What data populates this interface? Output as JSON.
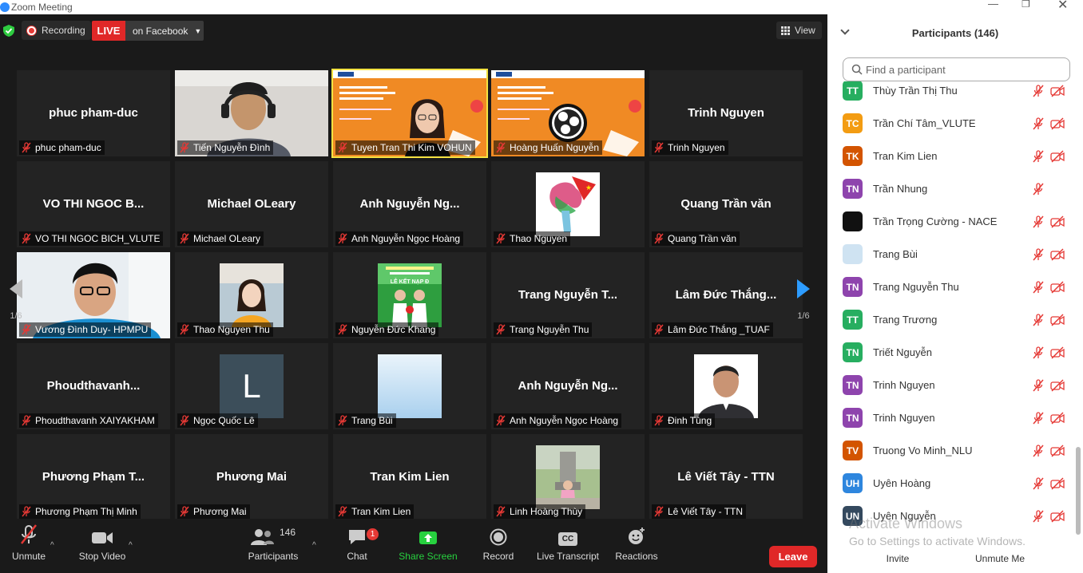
{
  "window": {
    "title": "Zoom Meeting"
  },
  "topbar": {
    "recording_label": "Recording",
    "live_badge": "LIVE",
    "live_target": "on Facebook",
    "view_label": "View"
  },
  "pager": {
    "left": "1/6",
    "right": "1/6"
  },
  "tiles": [
    {
      "big": "phuc pham-duc",
      "label": "phuc pham-duc",
      "kind": "name"
    },
    {
      "big": "",
      "label": "Tiến Nguyễn Đình",
      "kind": "video-man-headset"
    },
    {
      "big": "",
      "label": "Tuyen Tran Thi Kim VOHUN",
      "kind": "video-slide-woman",
      "active": true
    },
    {
      "big": "",
      "label": "Hoàng Huấn Nguyễn",
      "kind": "video-slide-obs"
    },
    {
      "big": "Trinh Nguyen",
      "label": "Trinh Nguyen",
      "kind": "name"
    },
    {
      "big": "VO THI NGOC B...",
      "label": "VO THI NGOC BICH_VLUTE",
      "kind": "name"
    },
    {
      "big": "Michael OLeary",
      "label": "Michael OLeary",
      "kind": "name"
    },
    {
      "big": "Anh  Nguyễn  Ng...",
      "label": "Anh Nguyễn Ngọc Hoàng",
      "kind": "name"
    },
    {
      "big": "",
      "label": "Thao Nguyen",
      "kind": "thumb-art"
    },
    {
      "big": "Quang Trần văn",
      "label": "Quang Trần văn",
      "kind": "name"
    },
    {
      "big": "",
      "label": "Vương Đình Duy- HPMPU",
      "kind": "video-young-man"
    },
    {
      "big": "",
      "label": "Thao Nguyen Thu",
      "kind": "thumb-woman"
    },
    {
      "big": "",
      "label": "Nguyễn Đức Khang",
      "kind": "thumb-banner"
    },
    {
      "big": "Trang  Nguyễn  T...",
      "label": "Trang Nguyễn Thu",
      "kind": "name"
    },
    {
      "big": "Lâm  Đức  Thắng...",
      "label": "Lâm Đức Thắng _TUAF",
      "kind": "name"
    },
    {
      "big": "Phoudthavanh...",
      "label": "Phoudthavanh XAIYAKHAM",
      "kind": "name"
    },
    {
      "big": "",
      "label": "Ngọc Quốc Lê",
      "kind": "thumb-letter",
      "letter": "L"
    },
    {
      "big": "",
      "label": "Trang Bùi",
      "kind": "thumb-sky"
    },
    {
      "big": "Anh  Nguyễn  Ng...",
      "label": "Anh Nguyễn Ngọc Hoàng",
      "kind": "name"
    },
    {
      "big": "",
      "label": "Đinh Tùng",
      "kind": "thumb-portrait"
    },
    {
      "big": "Phương  Phạm  T...",
      "label": "Phương Phạm Thị Minh",
      "kind": "name"
    },
    {
      "big": "Phương Mai",
      "label": "Phương Mai",
      "kind": "name"
    },
    {
      "big": "Tran Kim Lien",
      "label": "Tran Kim Lien",
      "kind": "name"
    },
    {
      "big": "",
      "label": "Linh Hoàng Thùy",
      "kind": "thumb-statue"
    },
    {
      "big": "Lê Viết Tây - TTN",
      "label": "Lê Viết Tây - TTN",
      "kind": "name"
    }
  ],
  "toolbar": {
    "unmute": "Unmute",
    "stop_video": "Stop Video",
    "participants": "Participants",
    "participants_count": "146",
    "chat": "Chat",
    "chat_badge": "1",
    "share_screen": "Share Screen",
    "record": "Record",
    "live_transcript": "Live Transcript",
    "transcript_icon_text": "CC",
    "reactions": "Reactions",
    "leave": "Leave"
  },
  "panel": {
    "title": "Participants (146)",
    "search_placeholder": "Find a participant",
    "invite": "Invite",
    "unmute_me": "Unmute Me",
    "participants": [
      {
        "initials": "TT",
        "color": "#27ae60",
        "name": "Thùy Trần Thị Thu",
        "cam": true
      },
      {
        "initials": "TC",
        "color": "#f39c12",
        "name": "Trần Chí Tâm_VLUTE",
        "cam": true
      },
      {
        "initials": "TK",
        "color": "#d35400",
        "name": "Tran Kim Lien",
        "cam": true
      },
      {
        "initials": "TN",
        "color": "#8e44ad",
        "name": "Trần Nhung",
        "cam": false
      },
      {
        "initials": "",
        "color": "#111111",
        "name": "Trần Trọng Cường - NACE",
        "cam": true
      },
      {
        "initials": "",
        "color": "#cfe3f2",
        "name": "Trang Bùi",
        "cam": true
      },
      {
        "initials": "TN",
        "color": "#8e44ad",
        "name": "Trang Nguyễn Thu",
        "cam": true
      },
      {
        "initials": "TT",
        "color": "#27ae60",
        "name": "Trang Trương",
        "cam": true
      },
      {
        "initials": "TN",
        "color": "#27ae60",
        "name": "Triết Nguyễn",
        "cam": true
      },
      {
        "initials": "TN",
        "color": "#8e44ad",
        "name": "Trinh Nguyen",
        "cam": true
      },
      {
        "initials": "TN",
        "color": "#8e44ad",
        "name": "Trinh Nguyen",
        "cam": true
      },
      {
        "initials": "TV",
        "color": "#d35400",
        "name": "Truong Vo Minh_NLU",
        "cam": true
      },
      {
        "initials": "UH",
        "color": "#2e86de",
        "name": "Uyên Hoàng",
        "cam": true
      },
      {
        "initials": "UN",
        "color": "#34495e",
        "name": "Uyên Nguyễn",
        "cam": true
      }
    ]
  },
  "watermark": {
    "line1": "Activate Windows",
    "line2": "Go to Settings to activate Windows."
  },
  "colors": {
    "live_red": "#e02828",
    "share_green": "#27d13f",
    "active_speaker": "#f5e342",
    "mute_red": "#e53935"
  }
}
